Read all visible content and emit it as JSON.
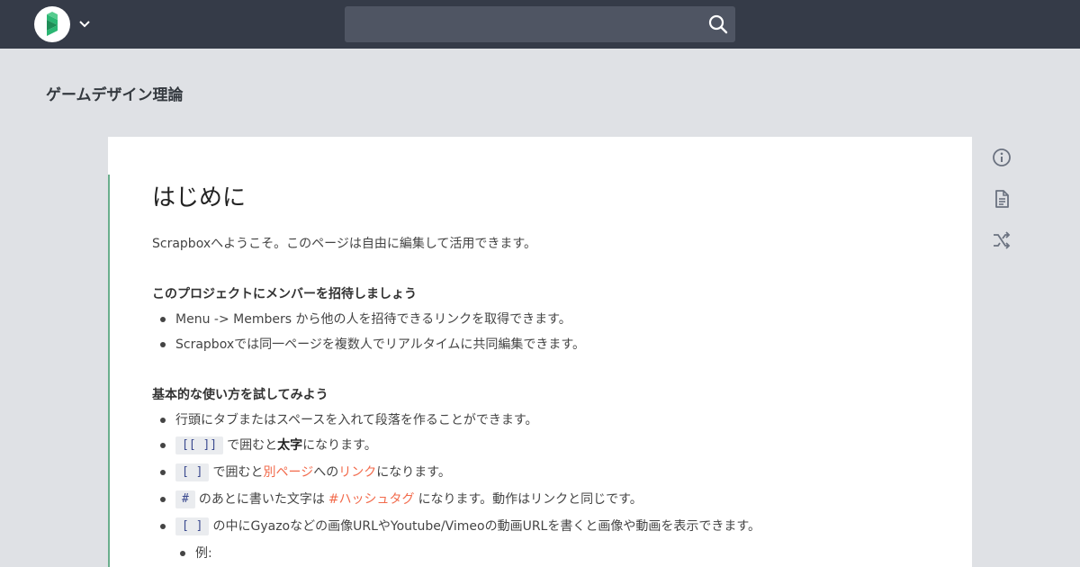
{
  "navbar": {
    "brand_icon": "scrapbox-logo-icon",
    "project_menu_icon": "chevron-down-icon",
    "search": {
      "placeholder": "",
      "value": "",
      "icon": "search-icon"
    }
  },
  "project": {
    "title": "ゲームデザイン理論"
  },
  "page": {
    "title": "はじめに",
    "intro": "Scrapboxへようこそ。このページは自由に編集して活用できます。",
    "section1": {
      "heading": "このプロジェクトにメンバーを招待しましょう",
      "items": [
        "Menu -> Members から他の人を招待できるリンクを取得できます。",
        "Scrapboxでは同一ページを複数人でリアルタイムに共同編集できます。"
      ]
    },
    "section2": {
      "heading": "基本的な使い方を試してみよう",
      "item1": "行頭にタブまたはスペースを入れて段落を作ることができます。",
      "item2": {
        "code": "[[ ]]",
        "text_a": "で囲むと",
        "bold": "太字",
        "text_b": "になります。"
      },
      "item3": {
        "code": "[ ]",
        "text_a": "で囲むと",
        "link1": "別ページ",
        "text_b": "への",
        "link2": "リンク",
        "text_c": "になります。"
      },
      "item4": {
        "code": "#",
        "text_a": "のあとに書いた文字は",
        "hashtag": "#ハッシュタグ",
        "text_b": "になります。動作はリンクと同じです。"
      },
      "item5": {
        "code": "[ ]",
        "text": "の中にGyazoなどの画像URLやYoutube/Vimeoの動画URLを書くと画像や動画を表示できます。"
      },
      "sub_item": "例:"
    }
  },
  "side_tools": {
    "info_icon": "info-icon",
    "document_icon": "document-icon",
    "shuffle_icon": "shuffle-icon"
  },
  "colors": {
    "navbar": "#353b48",
    "background": "#dfe1e5",
    "link": "#f26a4b",
    "brand_green": "#28b26b"
  }
}
